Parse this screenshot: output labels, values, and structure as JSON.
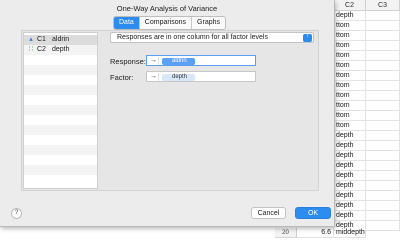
{
  "worksheet": {
    "columns": [
      "C2",
      "C3"
    ],
    "c2_values": [
      "depth",
      "ttom",
      "ttom",
      "ttom",
      "ttom",
      "ttom",
      "ttom",
      "ttom",
      "ttom",
      "ttom",
      "ttom",
      "ttom",
      "depth",
      "depth",
      "depth",
      "depth",
      "depth",
      "depth",
      "depth",
      "depth",
      "depth",
      "depth"
    ],
    "last_row": {
      "row": "20",
      "value": "6.6",
      "text": "middepth"
    }
  },
  "dialog": {
    "title": "One-Way Analysis of Variance",
    "tabs": [
      {
        "label": "Data",
        "active": true
      },
      {
        "label": "Comparisons",
        "active": false
      },
      {
        "label": "Graphs",
        "active": false
      }
    ],
    "variables": [
      {
        "icon": "numeric-column-icon",
        "glyph": "▴",
        "col": "C1",
        "name": "aldrin"
      },
      {
        "icon": "text-column-icon",
        "glyph": "∷",
        "col": "C2",
        "name": "depth"
      }
    ],
    "layout_select": {
      "value": "Responses are in one column for all factor levels",
      "chevron": "↕"
    },
    "response": {
      "label": "Response:",
      "arrow": "→",
      "value": "aldrin"
    },
    "factor": {
      "label": "Factor:",
      "arrow": "→",
      "value": "depth"
    },
    "help": "?",
    "cancel_label": "Cancel",
    "ok_label": "OK"
  },
  "colors": {
    "accent": "#2d8cf0",
    "dialog_bg": "#ececec"
  }
}
